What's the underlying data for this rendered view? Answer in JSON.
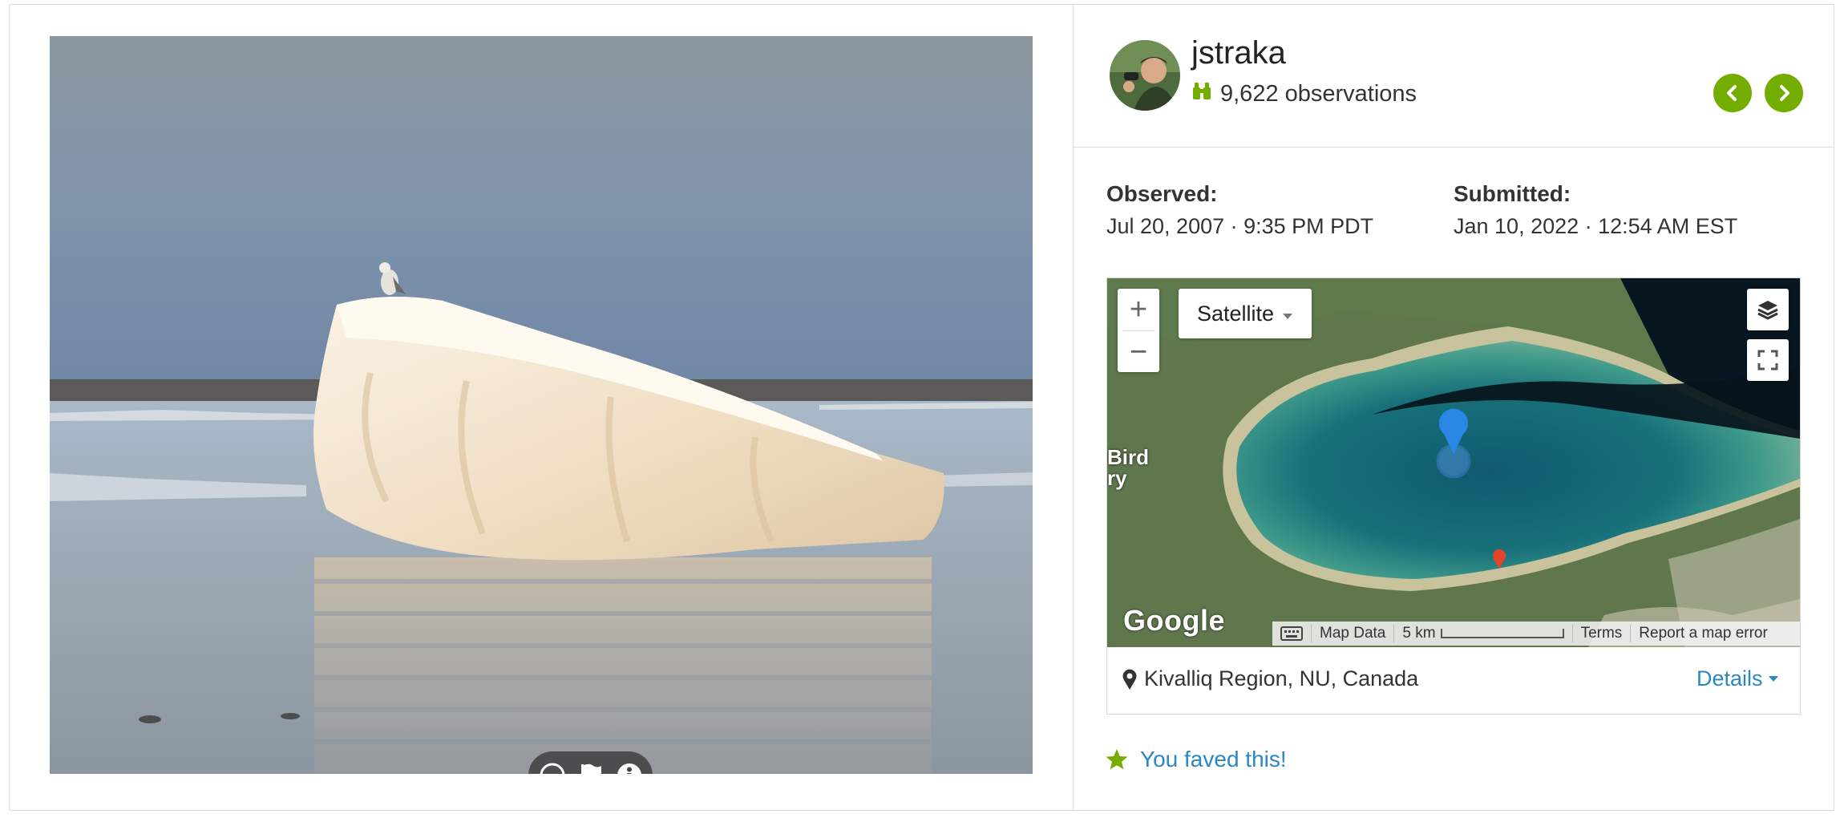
{
  "user": {
    "name": "jstraka",
    "observations": "9,622 observations"
  },
  "observed": {
    "label": "Observed:",
    "value": "Jul 20, 2007 · 9:35 PM PDT"
  },
  "submitted": {
    "label": "Submitted:",
    "value": "Jan 10, 2022 · 12:54 AM EST"
  },
  "map": {
    "zoom_in": "+",
    "zoom_out": "−",
    "map_type": "Satellite",
    "google": "Google",
    "edge_label_1": "Bird",
    "edge_label_2": "ry",
    "footer": {
      "map_data": "Map Data",
      "scale": "5 km",
      "terms": "Terms",
      "report": "Report a map error"
    }
  },
  "location": {
    "text": "Kivalliq Region, NU, Canada",
    "details": "Details"
  },
  "fave": {
    "text": "You faved this!"
  },
  "colors": {
    "accent_green": "#74ac00",
    "link_blue": "#2b86c4",
    "marker_blue": "#1e88e5",
    "marker_red": "#e5432a"
  },
  "icons": {
    "photo_controls": [
      "cc-license-icon",
      "flag-icon",
      "info-icon"
    ],
    "nav": [
      "chevron-left-icon",
      "chevron-right-icon"
    ]
  }
}
